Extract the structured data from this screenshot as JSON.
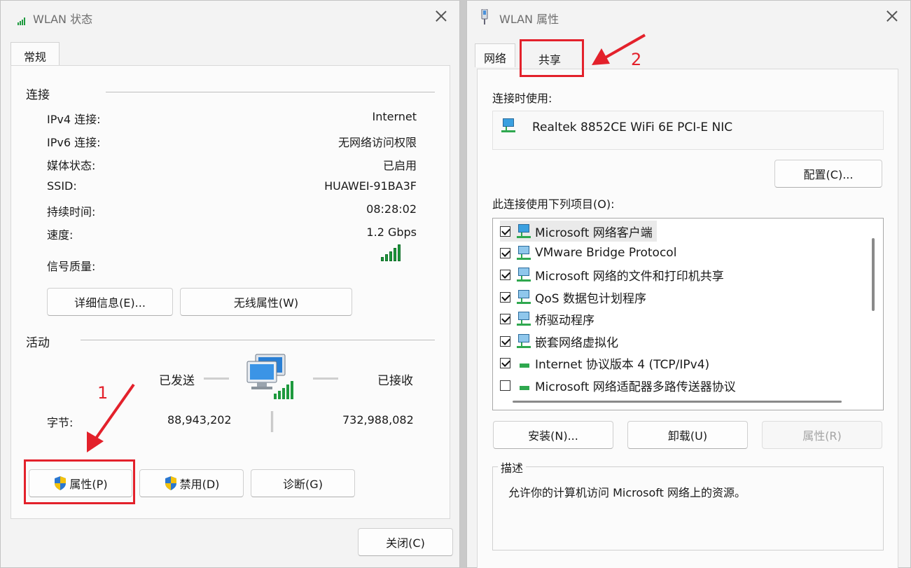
{
  "status_window": {
    "title": "WLAN 状态",
    "tab": "常规",
    "connection_group": "连接",
    "rows": [
      {
        "label": "IPv4 连接:",
        "value": "Internet"
      },
      {
        "label": "IPv6 连接:",
        "value": "无网络访问权限"
      },
      {
        "label": "媒体状态:",
        "value": "已启用"
      },
      {
        "label": "SSID:",
        "value": "HUAWEI-91BA3F"
      },
      {
        "label": "持续时间:",
        "value": "08:28:02"
      },
      {
        "label": "速度:",
        "value": "1.2 Gbps"
      }
    ],
    "signal_label": "信号质量:",
    "details_button": "详细信息(E)...",
    "wireless_props_button": "无线属性(W)",
    "activity_group": "活动",
    "sent_label": "已发送",
    "received_label": "已接收",
    "bytes_label": "字节:",
    "bytes_sent": "88,943,202",
    "bytes_received": "732,988,082",
    "properties_button": "属性(P)",
    "disable_button": "禁用(D)",
    "diagnose_button": "诊断(G)",
    "close_button": "关闭(C)"
  },
  "props_window": {
    "title": "WLAN 属性",
    "tab_network": "网络",
    "tab_sharing": "共享",
    "connect_using_label": "连接时使用:",
    "adapter_name": "Realtek 8852CE WiFi 6E PCI-E NIC",
    "configure_button": "配置(C)...",
    "items_label": "此连接使用下列项目(O):",
    "items": [
      {
        "label": "Microsoft 网络客户端",
        "checked": true,
        "icon": "network-client-icon"
      },
      {
        "label": "VMware Bridge Protocol",
        "checked": true,
        "icon": "network-service-icon"
      },
      {
        "label": "Microsoft 网络的文件和打印机共享",
        "checked": true,
        "icon": "network-service-icon"
      },
      {
        "label": "QoS 数据包计划程序",
        "checked": true,
        "icon": "network-service-icon"
      },
      {
        "label": "桥驱动程序",
        "checked": true,
        "icon": "network-service-icon"
      },
      {
        "label": "嵌套网络虚拟化",
        "checked": true,
        "icon": "network-service-icon"
      },
      {
        "label": "Internet 协议版本 4 (TCP/IPv4)",
        "checked": true,
        "icon": "protocol-icon"
      },
      {
        "label": "Microsoft 网络适配器多路传送器协议",
        "checked": false,
        "icon": "protocol-icon"
      }
    ],
    "install_button": "安装(N)...",
    "uninstall_button": "卸载(U)",
    "properties_button": "属性(R)",
    "description_group": "描述",
    "description_text": "允许你的计算机访问 Microsoft 网络上的资源。"
  },
  "annotations": {
    "step1": "1",
    "step2": "2",
    "color": "#e3212b"
  },
  "signal_level": "5 of 5 bars",
  "accent_color": "#1e9a3e"
}
